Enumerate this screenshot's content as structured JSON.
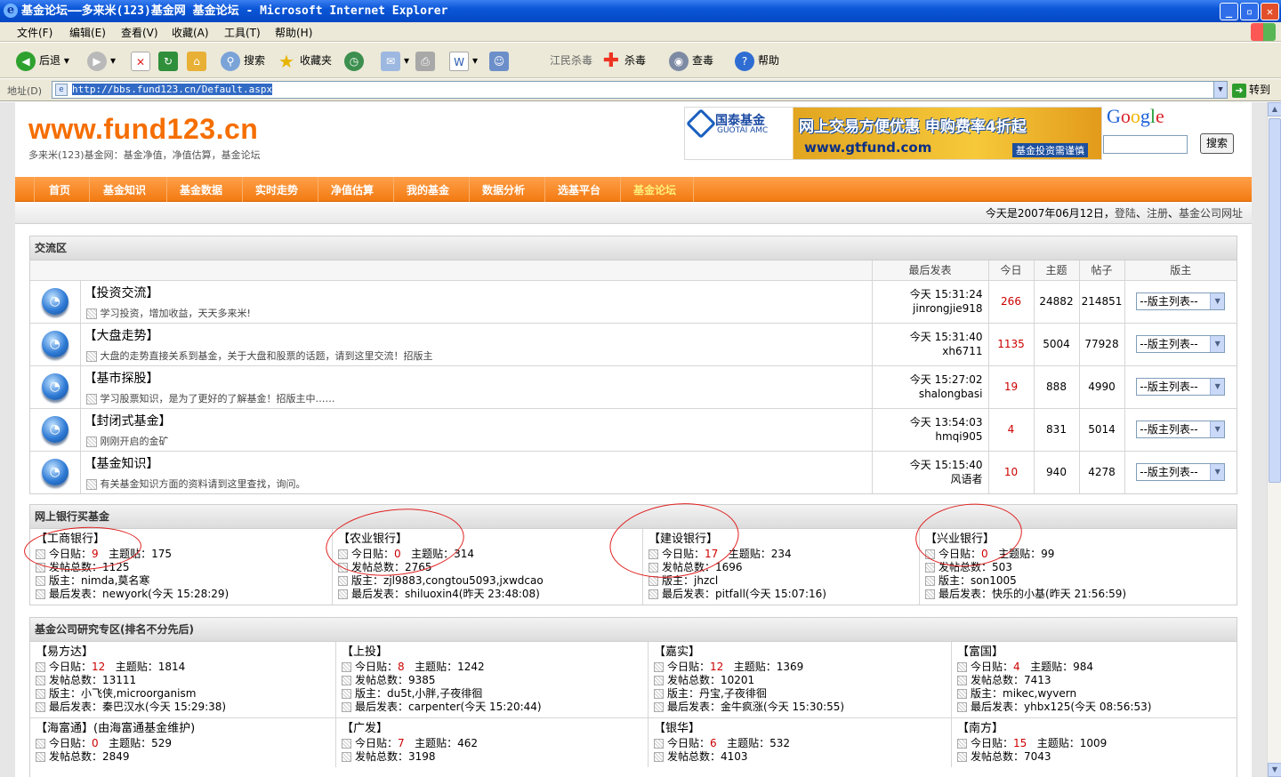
{
  "window": {
    "title": "基金论坛——多来米(123)基金网 基金论坛 - Microsoft Internet Explorer",
    "min": "_",
    "max": "▫",
    "close": "✕"
  },
  "menus": [
    "文件(F)",
    "编辑(E)",
    "查看(V)",
    "收藏(A)",
    "工具(T)",
    "帮助(H)"
  ],
  "toolbar": {
    "back": "后退",
    "search": "搜索",
    "favorites": "收藏夹",
    "jiangmin": "江民杀毒",
    "kill": "杀毒",
    "scan": "查毒",
    "help": "帮助"
  },
  "address": {
    "label": "地址(D)",
    "url": "http://bbs.fund123.cn/Default.aspx",
    "go": "转到"
  },
  "site": {
    "logo": "www.fund123.cn",
    "tagline": "多来米(123)基金网：基金净值，净值估算，基金论坛",
    "banner": {
      "brand": "国泰基金",
      "brand_en": "GUOTAI AMC",
      "slogan": "网上交易方便优惠 申购费率4折起",
      "url": "www.gtfund.com",
      "sub": "基金投资需谨慎"
    },
    "google": {
      "logo": "Google",
      "button": "搜索"
    },
    "nav": [
      "首页",
      "基金知识",
      "基金数据",
      "实时走势",
      "净值估算",
      "我的基金",
      "数据分析",
      "选基平台",
      "基金论坛"
    ],
    "date": {
      "prefix": "今天是2007年06月12日，",
      "login": "登陆",
      "sep1": "、",
      "register": "注册",
      "sep2": "、",
      "companies": "基金公司网址"
    }
  },
  "exchange": {
    "title": "交流区",
    "headers": {
      "last": "最后发表",
      "today": "今日",
      "topics": "主题",
      "posts": "帖子",
      "mod": "版主"
    },
    "forums": [
      {
        "name": "【投资交流】",
        "desc": "学习投资，增加收益，天天多来米!",
        "time": "今天 15:31:24",
        "user": "jinrongjie918",
        "today": "266",
        "topics": "24882",
        "posts": "214851",
        "mod": "--版主列表--"
      },
      {
        "name": "【大盘走势】",
        "desc": "大盘的走势直接关系到基金，关于大盘和股票的话题，请到这里交流！招版主",
        "time": "今天 15:31:40",
        "user": "xh6711",
        "today": "1135",
        "topics": "5004",
        "posts": "77928",
        "mod": "--版主列表--"
      },
      {
        "name": "【基市探股】",
        "desc": "学习股票知识，是为了更好的了解基金！招版主中……",
        "time": "今天 15:27:02",
        "user": "shalongbasi",
        "today": "19",
        "topics": "888",
        "posts": "4990",
        "mod": "--版主列表--"
      },
      {
        "name": "【封闭式基金】",
        "desc": "刚刚开启的金矿",
        "time": "今天 13:54:03",
        "user": "hmqi905",
        "today": "4",
        "topics": "831",
        "posts": "5014",
        "mod": "--版主列表--"
      },
      {
        "name": "【基金知识】",
        "desc": "有关基金知识方面的资料请到这里查找，询问。",
        "time": "今天 15:15:40",
        "user": "风语者",
        "today": "10",
        "topics": "940",
        "posts": "4278",
        "mod": "--版主列表--"
      }
    ]
  },
  "labels": {
    "today": "今日贴：",
    "topics": "主题贴：",
    "total": "发帖总数：",
    "mod": "版主：",
    "last": "最后发表："
  },
  "banks": {
    "title": "网上银行买基金",
    "items": [
      {
        "name": "【工商银行】",
        "today": "9",
        "topics": "175",
        "total": "1125",
        "mod": "nimda,莫名寒",
        "last": "newyork(今天 15:28:29)"
      },
      {
        "name": "【农业银行】",
        "today": "0",
        "topics": "314",
        "total": "2765",
        "mod": "zjl9883,congtou5093,jxwdcao",
        "last": "shiluoxin4(昨天 23:48:08)"
      },
      {
        "name": "【建设银行】",
        "today": "17",
        "topics": "234",
        "total": "1696",
        "mod": "jhzcl",
        "last": "pitfall(今天 15:07:16)"
      },
      {
        "name": "【兴业银行】",
        "today": "0",
        "topics": "99",
        "total": "503",
        "mod": "son1005",
        "last": "快乐的小基(昨天 21:56:59)"
      }
    ]
  },
  "companies": {
    "title": "基金公司研究专区(排名不分先后)",
    "row1": [
      {
        "name": "【易方达】",
        "today": "12",
        "topics": "1814",
        "total": "13111",
        "mod": "小飞侠,microorganism",
        "last": "秦巴汉水(今天 15:29:38)"
      },
      {
        "name": "【上投】",
        "today": "8",
        "topics": "1242",
        "total": "9385",
        "mod": "du5t,小胖,子夜徘徊",
        "last": "carpenter(今天 15:20:44)"
      },
      {
        "name": "【嘉实】",
        "today": "12",
        "topics": "1369",
        "total": "10201",
        "mod": "丹宝,子夜徘徊",
        "last": "金牛疯涨(今天 15:30:55)"
      },
      {
        "name": "【富国】",
        "today": "4",
        "topics": "984",
        "total": "7413",
        "mod": "mikec,wyvern",
        "last": "yhbx125(今天 08:56:53)"
      }
    ],
    "row2": [
      {
        "name": "【海富通】(由海富通基金维护)",
        "today": "0",
        "topics": "529",
        "total": "2849"
      },
      {
        "name": "【广发】",
        "today": "7",
        "topics": "462",
        "total": "3198"
      },
      {
        "name": "【银华】",
        "today": "6",
        "topics": "532",
        "total": "4103"
      },
      {
        "name": "【南方】",
        "today": "15",
        "topics": "1009",
        "total": "7043"
      }
    ]
  }
}
